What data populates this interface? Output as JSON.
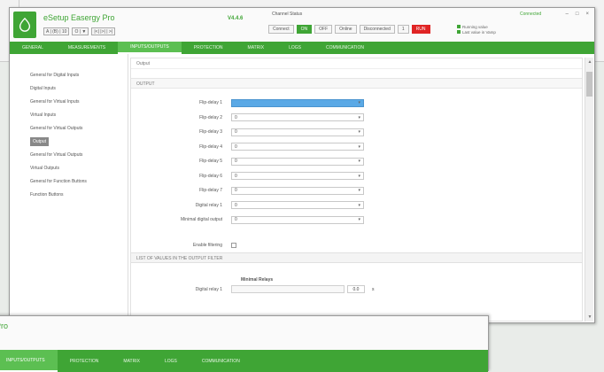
{
  "app": {
    "title": "eSetup Easergy Pro",
    "version": "V4.4.6",
    "toolbar": [
      "A | (B) | 10",
      "O | ▼",
      "|<| |>| | >|"
    ],
    "conn_label": "Channel  Status",
    "conn_buttons": [
      "Connect",
      "ON",
      "OFF",
      "Online",
      "Disconnected",
      "1",
      "RUN"
    ],
    "legend": [
      "Running value",
      "Last value in Vamp"
    ],
    "status": "Connected",
    "win_controls": [
      "–",
      "□",
      "×"
    ]
  },
  "menus": [
    "GENERAL",
    "MEASUREMENTS",
    "INPUTS/OUTPUTS",
    "PROTECTION",
    "MATRIX",
    "LOGS",
    "COMMUNICATION"
  ],
  "active_menu": 2,
  "sidebar": [
    "General for Digital Inputs",
    "Digital Inputs",
    "General for Virtual Inputs",
    "Virtual Inputs",
    "General for Virtual Outputs",
    "Output",
    "General for Virtual Outputs",
    "Virtual Outputs",
    "General for Function Buttons",
    "Function Buttons"
  ],
  "active_sidebar": 5,
  "content": {
    "breadcrumb": "Output",
    "section": "OUTPUT",
    "fields": [
      {
        "label": "Flip-delay 1",
        "value": ""
      },
      {
        "label": "Flip-delay 2",
        "value": "0"
      },
      {
        "label": "Flip-delay 3",
        "value": "0"
      },
      {
        "label": "Flip-delay 4",
        "value": "0"
      },
      {
        "label": "Flip-delay 5",
        "value": "0"
      },
      {
        "label": "Flip-delay 6",
        "value": "0"
      },
      {
        "label": "Flip-delay 7",
        "value": "0"
      },
      {
        "label": "Digital relay 1",
        "value": "0"
      },
      {
        "label": "Minimal digital output",
        "value": "0"
      }
    ],
    "enable_label": "Enable filtering",
    "table_head": "LIST OF VALUES IN THE OUTPUT FILTER",
    "col_head": "Minimal Relays",
    "row_label": "Digital relay 1",
    "row_num": "0.0",
    "row_unit": "s"
  },
  "win2": {
    "title": "Pro",
    "menus": [
      "INPUTS/OUTPUTS",
      "PROTECTION",
      "MATRIX",
      "LOGS",
      "COMMUNICATION"
    ]
  }
}
